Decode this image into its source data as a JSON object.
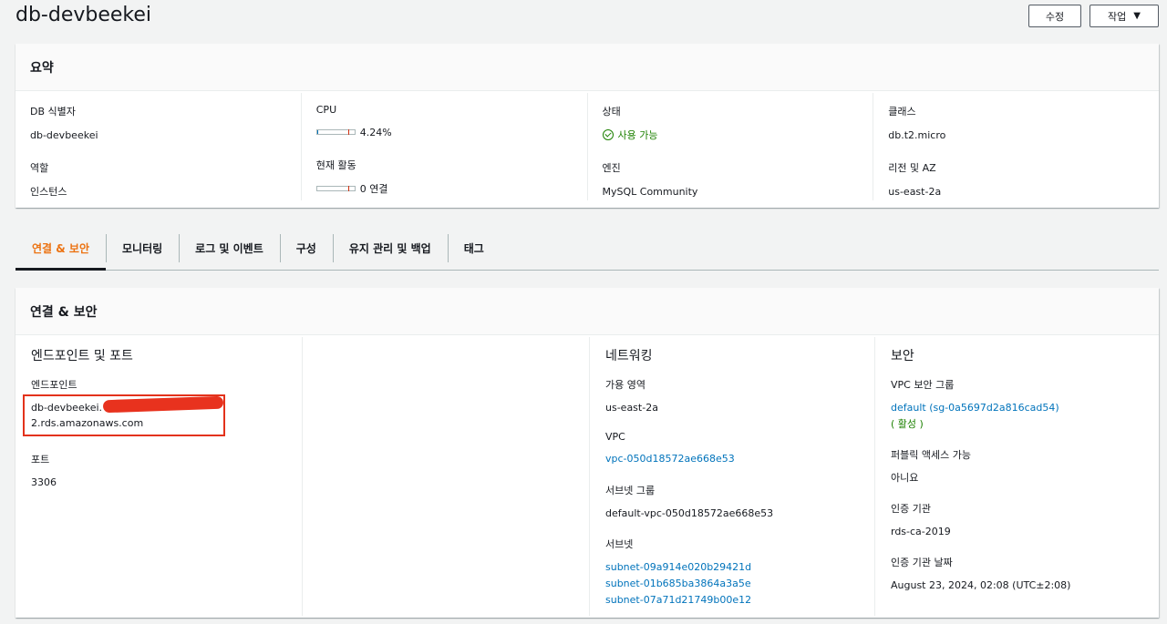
{
  "header": {
    "title": "db-devbeekei",
    "edit_label": "수정",
    "actions_label": "작업"
  },
  "summary": {
    "title": "요약",
    "columns": [
      {
        "a_label": "DB 식별자",
        "a_value": "db-devbeekei",
        "b_label": "역할",
        "b_value": "인스턴스"
      },
      {
        "a_label": "CPU",
        "a_value": "4.24%",
        "b_label": "현재 활동",
        "b_value": "0 연결"
      },
      {
        "a_label": "상태",
        "a_value": "사용 가능",
        "b_label": "엔진",
        "b_value": "MySQL Community"
      },
      {
        "a_label": "클래스",
        "a_value": "db.t2.micro",
        "b_label": "리전 및 AZ",
        "b_value": "us-east-2a"
      }
    ],
    "cpu_fraction": 0.0424,
    "connections": 0
  },
  "tabs": [
    {
      "label": "연결 & 보안",
      "active": true
    },
    {
      "label": "모니터링"
    },
    {
      "label": "로그 및 이벤트"
    },
    {
      "label": "구성"
    },
    {
      "label": "유지 관리 및 백업"
    },
    {
      "label": "태그"
    }
  ],
  "connectivity": {
    "title": "연결 & 보안",
    "endpoint_section": {
      "title": "엔드포인트 및 포트",
      "endpoint_label": "엔드포인트",
      "endpoint_line1": "db-devbeekei.",
      "endpoint_line2": "2.rds.amazonaws.com",
      "port_label": "포트",
      "port_value": "3306"
    },
    "networking": {
      "title": "네트워킹",
      "az_label": "가용 영역",
      "az_value": "us-east-2a",
      "vpc_label": "VPC",
      "vpc_value": "vpc-050d18572ae668e53",
      "subnet_group_label": "서브넷 그룹",
      "subnet_group_value": "default-vpc-050d18572ae668e53",
      "subnets_label": "서브넷",
      "subnets": [
        "subnet-09a914e020b29421d",
        "subnet-01b685ba3864a3a5e",
        "subnet-07a71d21749b00e12"
      ]
    },
    "security": {
      "title": "보안",
      "sg_label": "VPC 보안 그룹",
      "sg_value": "default (sg-0a5697d2a816cad54)",
      "sg_status": "( 활성 )",
      "public_label": "퍼블릭 액세스 가능",
      "public_value": "아니요",
      "ca_label": "인증 기관",
      "ca_value": "rds-ca-2019",
      "ca_date_label": "인증 기관 날짜",
      "ca_date_value": "August 23, 2024, 02:08 (UTC±2:08)"
    }
  },
  "colors": {
    "accent": "#ec7211",
    "link": "#0073bb",
    "success": "#1d8102",
    "highlight": "#e3321b"
  }
}
